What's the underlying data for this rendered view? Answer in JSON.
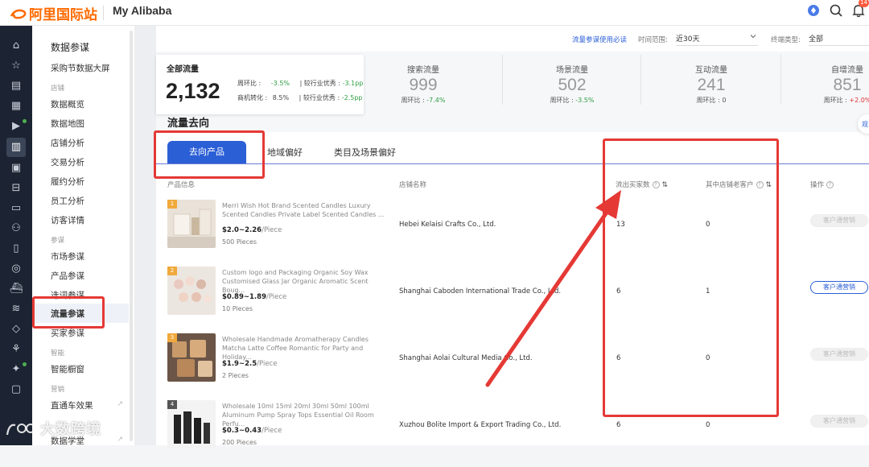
{
  "brand": {
    "logo_text": "阿里国际站",
    "product": "My Alibaba",
    "accent": "#ff6a00",
    "notification_count": "14"
  },
  "top_icons": [
    "assistant-icon",
    "search-icon",
    "bell-icon"
  ],
  "left_rail": [
    "home-icon",
    "star-icon",
    "store-icon",
    "calendar-icon",
    "video-icon",
    "chart-icon",
    "document-icon",
    "ticket-icon",
    "message-icon",
    "users-icon",
    "clipboard-icon",
    "globe-icon",
    "ship-icon",
    "coins-icon",
    "shield-icon",
    "plant-icon",
    "sparkle-icon",
    "box-icon"
  ],
  "menu": {
    "title": "数据参谋",
    "top_item": "采购节数据大屏",
    "groups": [
      {
        "label": "店铺",
        "items": [
          "数据概览",
          "数据地图",
          "店铺分析",
          "交易分析",
          "履约分析",
          "员工分析",
          "访客详情"
        ]
      },
      {
        "label": "参谋",
        "items": [
          "市场参谋",
          "产品参谋",
          "选词参谋",
          "流量参谋",
          "买家参谋"
        ]
      },
      {
        "label": "智能",
        "items": [
          "智能橱窗"
        ]
      },
      {
        "label": "营销",
        "items": [
          "直通车效果",
          "数据学堂"
        ]
      }
    ],
    "active": "流量参谋"
  },
  "filters": {
    "link": "流量参谋使用必读",
    "time_label": "时间范围:",
    "time_value": "近30天",
    "device_label": "终端类型:",
    "device_value": "全部"
  },
  "total": {
    "label": "全部流量",
    "value": "2,132",
    "wow_label": "周环比 :",
    "wow_value": "-3.5%",
    "industry_label": "| 较行业优秀 :",
    "industry_value": "-3.1pp",
    "conv_label": "商机转化 :",
    "conv_value": "8.5%",
    "conv_industry_label": "| 较行业优秀 :",
    "conv_industry_value": "-2.5pp"
  },
  "stats": [
    {
      "label": "搜索流量",
      "value": "999",
      "sub_label": "周环比 :",
      "sub_value": "-7.4%",
      "tone": "green"
    },
    {
      "label": "场景流量",
      "value": "502",
      "sub_label": "周环比 :",
      "sub_value": "-3.5%",
      "tone": "green"
    },
    {
      "label": "互动流量",
      "value": "241",
      "sub_label": "周环比 :",
      "sub_value": "0",
      "tone": "neutral"
    },
    {
      "label": "自增流量",
      "value": "851",
      "sub_label": "周环比 :",
      "sub_value": "+2.0%",
      "tone": "red"
    }
  ],
  "section_title": "流量去向",
  "right_bubble": "观",
  "tabs": [
    "去向产品",
    "地域偏好",
    "类目及场景偏好"
  ],
  "table": {
    "headers": {
      "product": "产品信息",
      "store": "店铺名称",
      "buyers": "流出买家数",
      "old_customers": "其中店铺老客户",
      "action": "操作"
    },
    "rows": [
      {
        "rank": "1",
        "title": "Merri Wish Hot Brand Scented Candles Luxury Scented Candles Private Label Scented Candles ...",
        "price": "$2.0~2.26",
        "unit": "/Piece",
        "moq": "500 Pieces",
        "store": "Hebei Kelaisi Crafts Co., Ltd.",
        "buyers": "13",
        "old": "0",
        "action": "客户通营销",
        "enabled": false
      },
      {
        "rank": "2",
        "title": "Custom logo and Packaging Organic Soy Wax Customised Glass Jar Organic Aromatic Scent Boug...",
        "price": "$0.89~1.89",
        "unit": "/Piece",
        "moq": "10 Pieces",
        "store": "Shanghai Caboden International Trade Co., Ltd.",
        "buyers": "6",
        "old": "1",
        "action": "客户通营销",
        "enabled": true
      },
      {
        "rank": "3",
        "title": "Wholesale Handmade Aromatherapy Candles Matcha Latte Coffee Romantic for Party and Holiday...",
        "price": "$1.9~2.5",
        "unit": "/Piece",
        "moq": "2 Pieces",
        "store": "Shanghai Aolai Cultural Media Co., Ltd.",
        "buyers": "6",
        "old": "0",
        "action": "客户通营销",
        "enabled": false
      },
      {
        "rank": "4",
        "title": "Wholesale 10ml 15ml 20ml 30ml 50ml 100ml Aluminum Pump Spray Tops Essential Oil Room Perfu...",
        "price": "$0.3~0.43",
        "unit": "/Piece",
        "moq": "200 Pieces",
        "store": "Xuzhou Bolite Import & Export Trading Co., Ltd.",
        "buyers": "6",
        "old": "0",
        "action": "客户通营销",
        "enabled": false
      }
    ]
  },
  "watermark": "大数跨境"
}
